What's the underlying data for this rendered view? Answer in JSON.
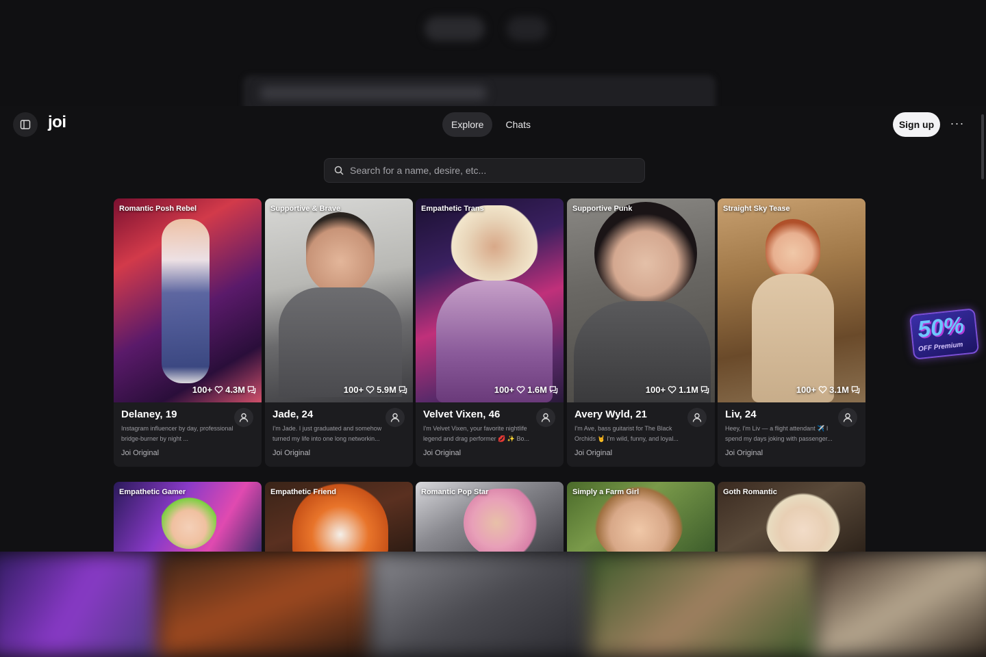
{
  "app": {
    "logo": "joi"
  },
  "nav": {
    "tabs": [
      {
        "label": "Explore"
      },
      {
        "label": "Chats"
      }
    ]
  },
  "header": {
    "signup_label": "Sign up",
    "more_label": "···"
  },
  "search": {
    "placeholder": "Search for a name, desire, etc..."
  },
  "promo": {
    "big": "50%",
    "small": "OFF Premium"
  },
  "characters": [
    {
      "tag": "Romantic Posh Rebel",
      "likes": "100+",
      "chats": "4.3M",
      "name": "Delaney, 19",
      "desc": "Instagram influencer by day, professional bridge-burner by night ...",
      "origin": "Joi Original"
    },
    {
      "tag": "Supportive & Brave",
      "likes": "100+",
      "chats": "5.9M",
      "name": "Jade, 24",
      "desc": "I'm Jade. I just graduated and somehow turned my life into one long networkin...",
      "origin": "Joi Original"
    },
    {
      "tag": "Empathetic Trans",
      "likes": "100+",
      "chats": "1.6M",
      "name": "Velvet Vixen, 46",
      "desc": "I'm Velvet Vixen, your favorite nightlife legend and drag performer 💋 ✨ Bo...",
      "origin": "Joi Original"
    },
    {
      "tag": "Supportive Punk",
      "likes": "100+",
      "chats": "1.1M",
      "name": "Avery Wyld, 21",
      "desc": "I'm Ave, bass guitarist for The Black Orchids 🤘 I'm wild, funny, and loyal...",
      "origin": "Joi Original"
    },
    {
      "tag": "Straight Sky Tease",
      "likes": "100+",
      "chats": "3.1M",
      "name": "Liv, 24",
      "desc": "Heey, I'm Liv — a flight attendant ✈️ I spend my days joking with passenger...",
      "origin": "Joi Original"
    }
  ],
  "characters_row2": [
    {
      "tag": "Empathetic Gamer"
    },
    {
      "tag": "Empathetic Friend"
    },
    {
      "tag": "Romantic Pop Star"
    },
    {
      "tag": "Simply a Farm Girl"
    },
    {
      "tag": "Goth Romantic"
    }
  ]
}
